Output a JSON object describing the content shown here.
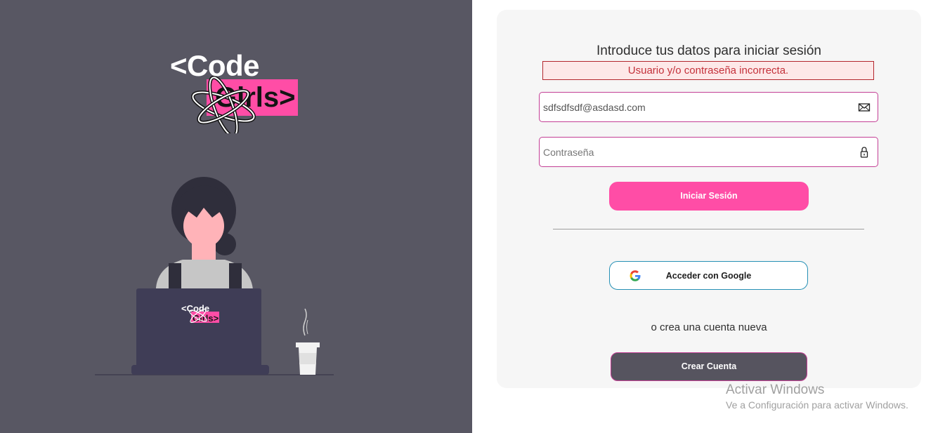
{
  "brand": {
    "code_text": "<Code",
    "girls_text": "Girls>",
    "laptop_code_text": "<Code",
    "laptop_girls_text": "Girls>"
  },
  "colors": {
    "left_panel": "#585763",
    "accent_pink": "#ff4da6",
    "error_red": "#c4313a",
    "card_bg": "#f6f6f6",
    "google_border": "#2690b5"
  },
  "login": {
    "title": "Introduce tus datos para iniciar sesión",
    "error_message": "Usuario y/o contraseña incorrecta.",
    "email": {
      "value": "sdfsdfsdf@asdasd.com",
      "icon": "envelope-icon"
    },
    "password": {
      "value": "",
      "placeholder": "Contraseña",
      "icon": "lock-icon"
    },
    "submit_label": "Iniciar Sesión",
    "google_label": "Acceder con Google",
    "google_icon": "google-icon",
    "or_text": "o crea una cuenta nueva",
    "create_label": "Crear Cuenta"
  },
  "watermark": {
    "title": "Activar Windows",
    "subtitle": "Ve a Configuración para activar Windows."
  }
}
